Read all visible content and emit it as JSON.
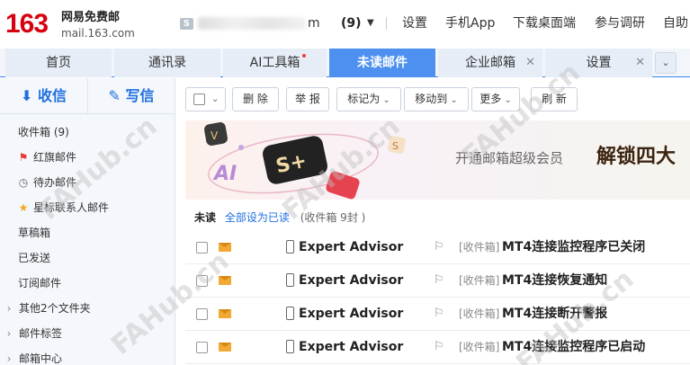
{
  "logo": {
    "number": "163",
    "name_cn": "网易免费邮",
    "domain": "mail.163.com"
  },
  "account": {
    "name_tail": "m",
    "count": "(9)"
  },
  "topnav": [
    "设置",
    "手机App",
    "下载桌面端",
    "参与调研",
    "自助"
  ],
  "tabs": [
    {
      "label": "首页"
    },
    {
      "label": "通讯录"
    },
    {
      "label": "AI工具箱"
    },
    {
      "label": "未读邮件"
    },
    {
      "label": "企业邮箱"
    },
    {
      "label": "设置"
    }
  ],
  "sidebar": {
    "receive": "收信",
    "write": "写信",
    "folders": [
      {
        "label": "收件箱 (9)"
      },
      {
        "label": "红旗邮件"
      },
      {
        "label": "待办邮件"
      },
      {
        "label": "星标联系人邮件"
      },
      {
        "label": "草稿箱"
      },
      {
        "label": "已发送"
      },
      {
        "label": "订阅邮件"
      },
      {
        "label": "其他2个文件夹"
      },
      {
        "label": "邮件标签"
      },
      {
        "label": "邮箱中心"
      }
    ]
  },
  "toolbar": {
    "delete": "删 除",
    "report": "举 报",
    "mark_as": "标记为",
    "move_to": "移动到",
    "more": "更多",
    "refresh": "刷 新"
  },
  "banner": {
    "text": "开通邮箱超级会员",
    "title": "解锁四大"
  },
  "list": {
    "heading": "未读",
    "mark_all": "全部设为已读",
    "summary": "(收件箱 9封 )"
  },
  "mails": [
    {
      "sender": "Expert Advisor",
      "folder": "[收件箱]",
      "subject": "MT4连接监控程序已关闭"
    },
    {
      "sender": "Expert Advisor",
      "folder": "[收件箱]",
      "subject": "MT4连接恢复通知"
    },
    {
      "sender": "Expert Advisor",
      "folder": "[收件箱]",
      "subject": "MT4连接断开警报"
    },
    {
      "sender": "Expert Advisor",
      "folder": "[收件箱]",
      "subject": "MT4连接监控程序已启动"
    }
  ],
  "watermark": "FAHub.cn",
  "colors": {
    "brand_red": "#d7000f",
    "accent_blue": "#4d90f0",
    "flag_red": "#e53935",
    "star": "#f5a623",
    "envelope": "#f1a933"
  }
}
